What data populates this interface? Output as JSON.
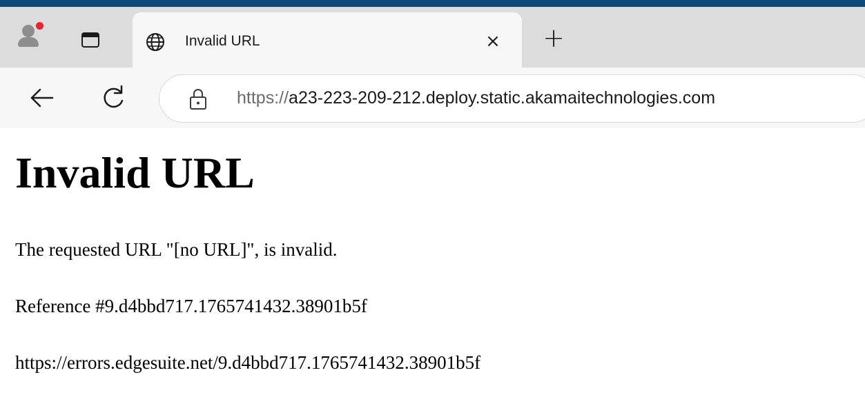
{
  "browser": {
    "tab": {
      "title": "Invalid URL",
      "close_glyph": "×",
      "icon": "globe-icon"
    },
    "new_tab_glyph": "+",
    "profile": {
      "icon": "profile-icon",
      "notification_color": "#e3262f"
    },
    "address_bar": {
      "scheme": "https://",
      "host": "a23-223-209-212.deploy.static.akamaitechnologies.com",
      "icon": "lock-icon"
    },
    "nav": {
      "back_icon": "back-arrow-icon",
      "refresh_icon": "refresh-icon"
    },
    "accent_color": "#0b4a78"
  },
  "page": {
    "heading": "Invalid URL",
    "message": "The requested URL \"[no URL]\", is invalid.",
    "reference": "Reference #9.d4bbd717.1765741432.38901b5f",
    "error_link": "https://errors.edgesuite.net/9.d4bbd717.1765741432.38901b5f"
  }
}
